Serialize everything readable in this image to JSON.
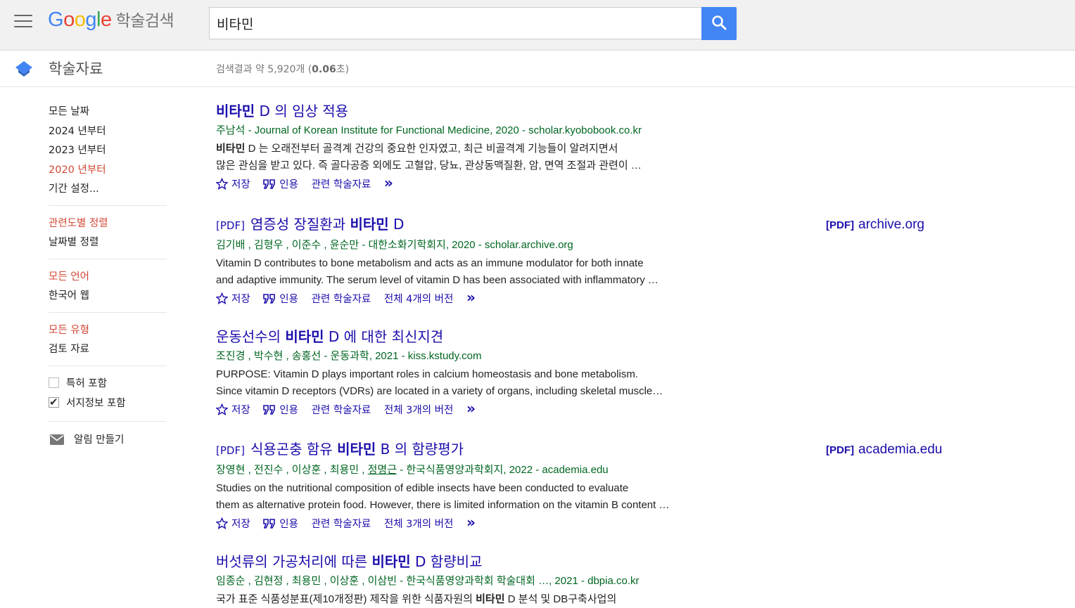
{
  "header": {
    "logo": {
      "g1": "G",
      "o1": "o",
      "o2": "o",
      "g2": "g",
      "l": "l",
      "e": "e",
      "sub": "학술검색"
    },
    "search_value": "비타민"
  },
  "subbar": {
    "section_title": "학술자료",
    "result_count_prefix": "검색결과 약 5,920개 (",
    "result_time": "0.06",
    "result_count_suffix": "초)"
  },
  "sidebar": {
    "date": [
      "모든 날짜",
      "2024 년부터",
      "2023 년부터",
      "2020 년부터",
      "기간 설정..."
    ],
    "sort": [
      "관련도별 정렬",
      "날짜별 정렬"
    ],
    "lang": [
      "모든 언어",
      "한국어 웹"
    ],
    "type": [
      "모든 유형",
      "검토 자료"
    ],
    "checks": [
      "특허 포함",
      "서지정보 포함"
    ],
    "alert": "알림 만들기"
  },
  "actions": {
    "save": "저장",
    "cite": "인용",
    "related": "관련 학술자료",
    "more": "»"
  },
  "results": [
    {
      "title_pre": "",
      "title_bold": "비타민",
      "title_post": " D 의 임상 적용",
      "authors_a": "주남석",
      "authors_b": " - Journal of Korean Institute for Functional Medicine, 2020 - scholar.kyobobook.co.kr",
      "snippet_bold": "비타민",
      "snippet_line1": " D 는 오래전부터 골격계 건강의 중요한 인자였고, 최근 비골격계 기능들이 알려지면서",
      "snippet_line2": "많은 관심을 받고 있다. 즉 골다공증 외에도 고혈압, 당뇨, 관상동맥질환, 암, 면역 조절과 관련이 …"
    },
    {
      "pdf_tag": "[PDF]",
      "title_pre": "염증성 장질환과 ",
      "title_bold": "비타민",
      "title_post": " D",
      "authors": "김기배 ,  김형우 ,  이준수 ,  윤순만 - 대한소화기학회지, 2020 - scholar.archive.org",
      "snippet_line1": "Vitamin D contributes to bone metabolism and acts as an immune modulator for both innate",
      "snippet_line2": "and adaptive immunity. The serum level of vitamin D has been associated with inflammatory …",
      "versions": "전체 4개의 버전",
      "side_tag": "[PDF]",
      "side_domain": "archive.org"
    },
    {
      "title_pre": "운동선수의 ",
      "title_bold": "비타민",
      "title_post": " D 에 대한 최신지견",
      "authors": "조진경 ,  박수현 ,  송홍선 - 운동과학, 2021 - kiss.kstudy.com",
      "snippet_line1": "PURPOSE: Vitamin D plays important roles in calcium homeostasis and bone metabolism.",
      "snippet_line2": "Since vitamin D receptors (VDRs) are located in a variety of organs, including skeletal muscle…",
      "versions": "전체 3개의 버전"
    },
    {
      "pdf_tag": "[PDF]",
      "title_pre": "식용곤충 함유 ",
      "title_bold": "비타민",
      "title_post": " B 의 함량평가",
      "authors_a": "장영현 ,  전진수 ,  이상훈 ,  최용민 ,  ",
      "authors_u": "정명근",
      "authors_b": " - 한국식품영양과학회지, 2022 - academia.edu",
      "snippet_line1": "Studies on the nutritional composition of edible insects have been conducted to evaluate",
      "snippet_line2": "them as alternative protein food. However, there is limited information on the vitamin B content …",
      "versions": "전체 3개의 버전",
      "side_tag": "[PDF]",
      "side_domain": "academia.edu"
    },
    {
      "title_pre": "버섯류의 가공처리에 따른 ",
      "title_bold": "비타민",
      "title_post": " D 함량비교",
      "authors": "임종순 ,  김현정 ,  최용민 ,  이상훈 ,  이삼빈 - 한국식품영양과학회 학술대회 …, 2021 - dbpia.co.kr",
      "snippet_pre": "국가 표준 식품성분표(제10개정판) 제작을 위한 식품자원의 ",
      "snippet_bold": "비타민",
      "snippet_post": " D 분석 및 DB구축사업의"
    }
  ]
}
